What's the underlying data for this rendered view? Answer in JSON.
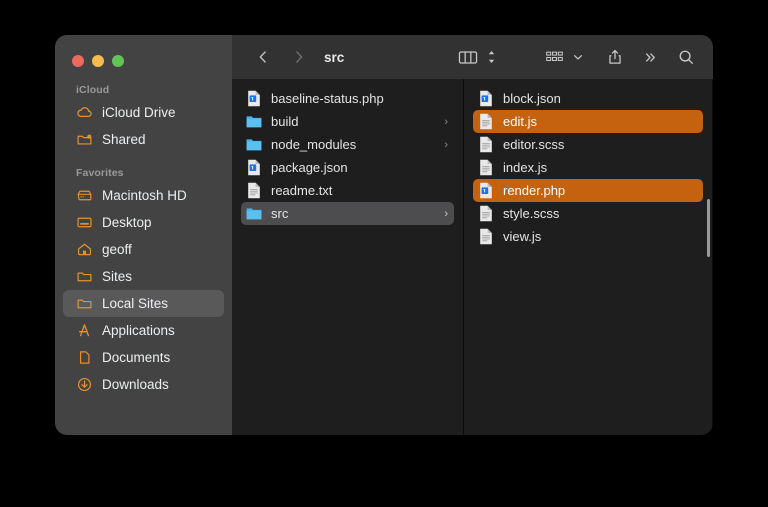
{
  "window": {
    "title": "src",
    "traffic_lights": [
      {
        "name": "close",
        "color": "#ed6a5e"
      },
      {
        "name": "minimize",
        "color": "#f5bd4f"
      },
      {
        "name": "zoom",
        "color": "#61c454"
      }
    ]
  },
  "toolbar": {
    "back_label": "‹",
    "forward_label": "›",
    "title": "src",
    "view_icon": "column-view-icon",
    "view_stepper_icon": "up-down-chevron-icon",
    "group_icon": "group-by-icon",
    "group_chevron": "chevron-down-icon",
    "share_icon": "share-icon",
    "more_label": "»",
    "search_icon": "search-icon"
  },
  "sidebar": {
    "sections": [
      {
        "label": "iCloud",
        "items": [
          {
            "label": "iCloud Drive",
            "icon": "cloud-icon",
            "selected": false
          },
          {
            "label": "Shared",
            "icon": "shared-folder-icon",
            "selected": false
          }
        ]
      },
      {
        "label": "Favorites",
        "items": [
          {
            "label": "Macintosh HD",
            "icon": "hard-drive-icon",
            "selected": false
          },
          {
            "label": "Desktop",
            "icon": "desktop-icon",
            "selected": false
          },
          {
            "label": "geoff",
            "icon": "home-icon",
            "selected": false
          },
          {
            "label": "Sites",
            "icon": "folder-icon",
            "selected": false
          },
          {
            "label": "Local Sites",
            "icon": "folder-icon",
            "selected": true
          },
          {
            "label": "Applications",
            "icon": "applications-icon",
            "selected": false
          },
          {
            "label": "Documents",
            "icon": "documents-icon",
            "selected": false
          },
          {
            "label": "Downloads",
            "icon": "downloads-icon",
            "selected": false
          }
        ]
      }
    ]
  },
  "columns": [
    {
      "name": "column-one",
      "items": [
        {
          "label": "baseline-status.php",
          "icon": "php-file-icon",
          "selection": "none",
          "disclosure": false
        },
        {
          "label": "build",
          "icon": "folder-icon",
          "selection": "none",
          "disclosure": true
        },
        {
          "label": "node_modules",
          "icon": "folder-icon",
          "selection": "none",
          "disclosure": true
        },
        {
          "label": "package.json",
          "icon": "php-file-icon",
          "selection": "none",
          "disclosure": false
        },
        {
          "label": "readme.txt",
          "icon": "text-file-icon",
          "selection": "none",
          "disclosure": false
        },
        {
          "label": "src",
          "icon": "folder-icon",
          "selection": "gray",
          "disclosure": true
        }
      ]
    },
    {
      "name": "column-two",
      "items": [
        {
          "label": "block.json",
          "icon": "php-file-icon",
          "selection": "none",
          "disclosure": false
        },
        {
          "label": "edit.js",
          "icon": "text-file-icon",
          "selection": "orange",
          "disclosure": false
        },
        {
          "label": "editor.scss",
          "icon": "text-file-icon",
          "selection": "none",
          "disclosure": false
        },
        {
          "label": "index.js",
          "icon": "text-file-icon",
          "selection": "none",
          "disclosure": false
        },
        {
          "label": "render.php",
          "icon": "php-file-icon",
          "selection": "orange",
          "disclosure": false
        },
        {
          "label": "style.scss",
          "icon": "text-file-icon",
          "selection": "none",
          "disclosure": false
        },
        {
          "label": "view.js",
          "icon": "text-file-icon",
          "selection": "none",
          "disclosure": false
        }
      ]
    }
  ],
  "colors": {
    "selection_orange": "#c4620f",
    "selection_gray": "#4d4d4f",
    "sidebar_bg": "#434343",
    "panel_bg": "#1e1e1e",
    "toolbar_bg": "#323232",
    "accent_orange": "#e8912d",
    "folder_blue": "#45b1ea"
  }
}
